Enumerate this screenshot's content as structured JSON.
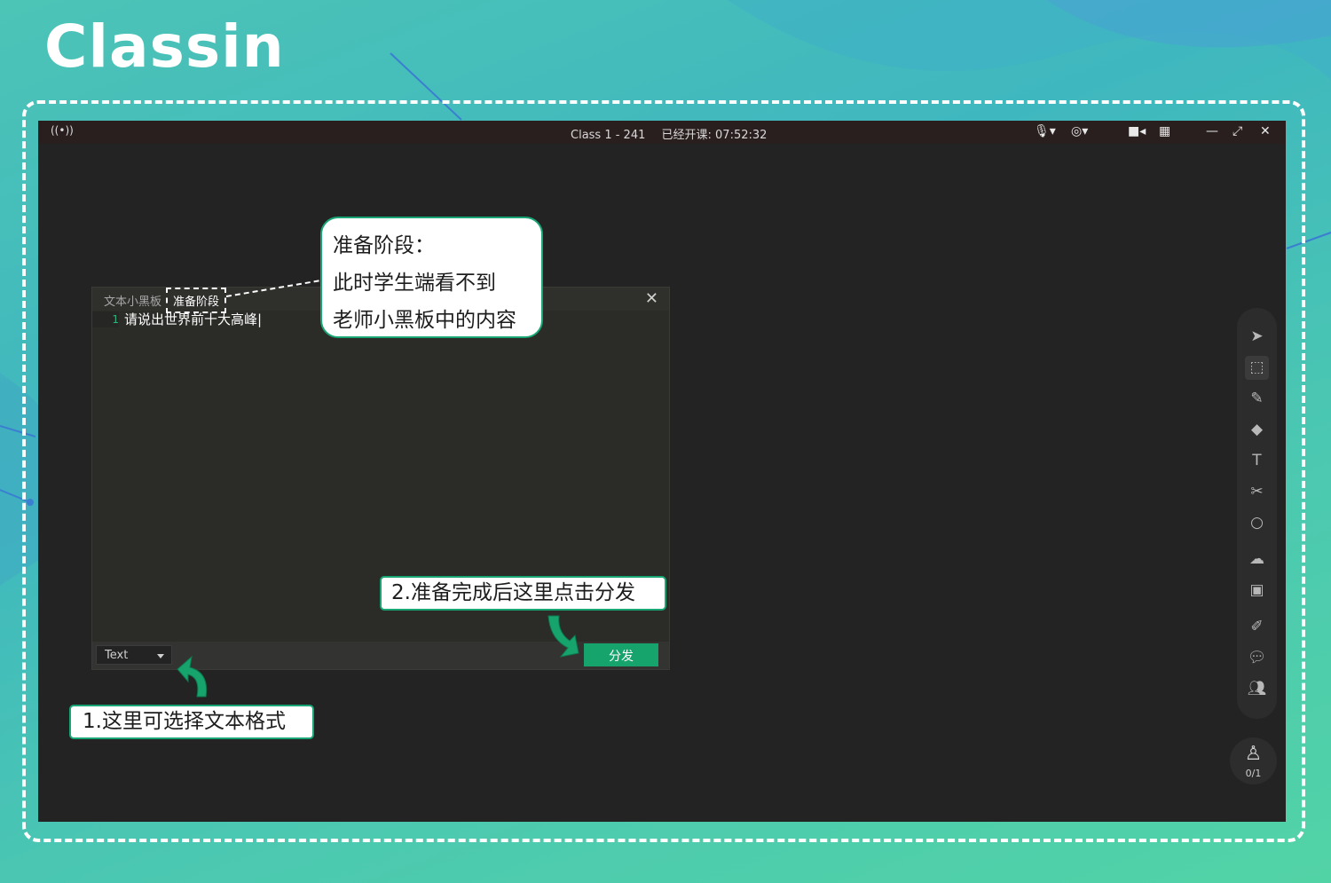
{
  "brand": {
    "logo_text": "Classin"
  },
  "titlebar": {
    "class_name": "Class 1 - 241",
    "elapsed": "已经开课: 07:52:32",
    "icons": [
      "signal-icon",
      "mic-off-icon",
      "camera-off-icon",
      "video-icon",
      "grid-icon",
      "minimize-icon",
      "fullscreen-icon",
      "close-icon"
    ]
  },
  "panel": {
    "tab_name": "文本小黑板",
    "stage_label": "准备阶段",
    "line_number": "1",
    "line_text": "请说出世界前十大高峰|",
    "format_value": "Text",
    "send_label": "分发"
  },
  "callouts": {
    "stage_lines": [
      "准备阶段：",
      "此时学生端看不到",
      "老师小黑板中的内容"
    ],
    "send_hint": "2.准备完成后这里点击分发",
    "format_hint": "1.这里可选择文本格式"
  },
  "toolbar": {
    "tools": [
      "pointer-icon",
      "select-icon",
      "laser-icon",
      "eraser-icon",
      "text-icon",
      "scissors-icon",
      "shape-icon",
      "cloud-icon",
      "toolbox-icon",
      "edit-icon",
      "chat-icon",
      "users-icon"
    ]
  },
  "seat": {
    "count": "0/1"
  },
  "colors": {
    "accent": "#16a36c",
    "background": "#4cc4b6",
    "window": "#232323"
  }
}
